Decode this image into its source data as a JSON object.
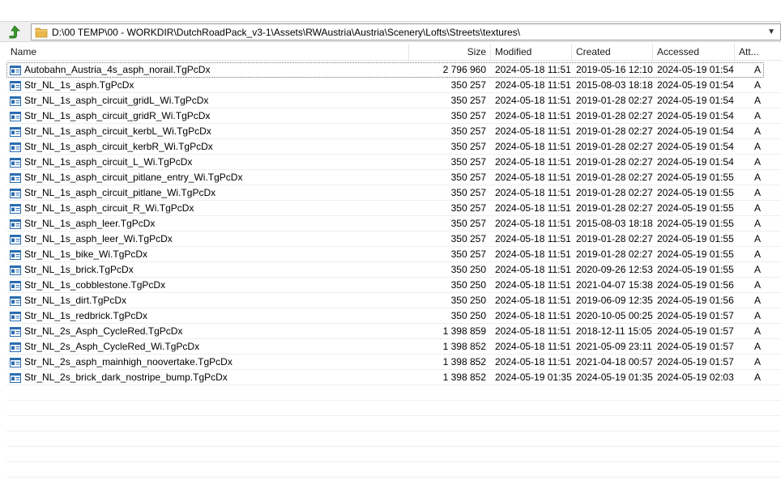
{
  "path_bar": {
    "path": "D:\\00 TEMP\\00 - WORKDIR\\DutchRoadPack_v3-1\\Assets\\RWAustria\\Austria\\Scenery\\Lofts\\Streets\\textures\\",
    "up_icon": "up-arrow-icon",
    "folder_icon": "folder-icon",
    "dropdown_icon": "chevron-down-icon"
  },
  "columns": {
    "name": "Name",
    "size": "Size",
    "modified": "Modified",
    "created": "Created",
    "accessed": "Accessed",
    "attributes": "Att..."
  },
  "files": [
    {
      "name": "Autobahn_Austria_4s_asph_norail.TgPcDx",
      "size": "2 796 960",
      "modified": "2024-05-18 11:51",
      "created": "2019-05-16 12:10",
      "accessed": "2024-05-19 01:54",
      "attr": "A"
    },
    {
      "name": "Str_NL_1s_asph.TgPcDx",
      "size": "350 257",
      "modified": "2024-05-18 11:51",
      "created": "2015-08-03 18:18",
      "accessed": "2024-05-19 01:54",
      "attr": "A"
    },
    {
      "name": "Str_NL_1s_asph_circuit_gridL_Wi.TgPcDx",
      "size": "350 257",
      "modified": "2024-05-18 11:51",
      "created": "2019-01-28 02:27",
      "accessed": "2024-05-19 01:54",
      "attr": "A"
    },
    {
      "name": "Str_NL_1s_asph_circuit_gridR_Wi.TgPcDx",
      "size": "350 257",
      "modified": "2024-05-18 11:51",
      "created": "2019-01-28 02:27",
      "accessed": "2024-05-19 01:54",
      "attr": "A"
    },
    {
      "name": "Str_NL_1s_asph_circuit_kerbL_Wi.TgPcDx",
      "size": "350 257",
      "modified": "2024-05-18 11:51",
      "created": "2019-01-28 02:27",
      "accessed": "2024-05-19 01:54",
      "attr": "A"
    },
    {
      "name": "Str_NL_1s_asph_circuit_kerbR_Wi.TgPcDx",
      "size": "350 257",
      "modified": "2024-05-18 11:51",
      "created": "2019-01-28 02:27",
      "accessed": "2024-05-19 01:54",
      "attr": "A"
    },
    {
      "name": "Str_NL_1s_asph_circuit_L_Wi.TgPcDx",
      "size": "350 257",
      "modified": "2024-05-18 11:51",
      "created": "2019-01-28 02:27",
      "accessed": "2024-05-19 01:54",
      "attr": "A"
    },
    {
      "name": "Str_NL_1s_asph_circuit_pitlane_entry_Wi.TgPcDx",
      "size": "350 257",
      "modified": "2024-05-18 11:51",
      "created": "2019-01-28 02:27",
      "accessed": "2024-05-19 01:55",
      "attr": "A"
    },
    {
      "name": "Str_NL_1s_asph_circuit_pitlane_Wi.TgPcDx",
      "size": "350 257",
      "modified": "2024-05-18 11:51",
      "created": "2019-01-28 02:27",
      "accessed": "2024-05-19 01:55",
      "attr": "A"
    },
    {
      "name": "Str_NL_1s_asph_circuit_R_Wi.TgPcDx",
      "size": "350 257",
      "modified": "2024-05-18 11:51",
      "created": "2019-01-28 02:27",
      "accessed": "2024-05-19 01:55",
      "attr": "A"
    },
    {
      "name": "Str_NL_1s_asph_leer.TgPcDx",
      "size": "350 257",
      "modified": "2024-05-18 11:51",
      "created": "2015-08-03 18:18",
      "accessed": "2024-05-19 01:55",
      "attr": "A"
    },
    {
      "name": "Str_NL_1s_asph_leer_Wi.TgPcDx",
      "size": "350 257",
      "modified": "2024-05-18 11:51",
      "created": "2019-01-28 02:27",
      "accessed": "2024-05-19 01:55",
      "attr": "A"
    },
    {
      "name": "Str_NL_1s_bike_Wi.TgPcDx",
      "size": "350 257",
      "modified": "2024-05-18 11:51",
      "created": "2019-01-28 02:27",
      "accessed": "2024-05-19 01:55",
      "attr": "A"
    },
    {
      "name": "Str_NL_1s_brick.TgPcDx",
      "size": "350 250",
      "modified": "2024-05-18 11:51",
      "created": "2020-09-26 12:53",
      "accessed": "2024-05-19 01:55",
      "attr": "A"
    },
    {
      "name": "Str_NL_1s_cobblestone.TgPcDx",
      "size": "350 250",
      "modified": "2024-05-18 11:51",
      "created": "2021-04-07 15:38",
      "accessed": "2024-05-19 01:56",
      "attr": "A"
    },
    {
      "name": "Str_NL_1s_dirt.TgPcDx",
      "size": "350 250",
      "modified": "2024-05-18 11:51",
      "created": "2019-06-09 12:35",
      "accessed": "2024-05-19 01:56",
      "attr": "A"
    },
    {
      "name": "Str_NL_1s_redbrick.TgPcDx",
      "size": "350 250",
      "modified": "2024-05-18 11:51",
      "created": "2020-10-05 00:25",
      "accessed": "2024-05-19 01:57",
      "attr": "A"
    },
    {
      "name": "Str_NL_2s_Asph_CycleRed.TgPcDx",
      "size": "1 398 859",
      "modified": "2024-05-18 11:51",
      "created": "2018-12-11 15:05",
      "accessed": "2024-05-19 01:57",
      "attr": "A"
    },
    {
      "name": "Str_NL_2s_Asph_CycleRed_Wi.TgPcDx",
      "size": "1 398 852",
      "modified": "2024-05-18 11:51",
      "created": "2021-05-09 23:11",
      "accessed": "2024-05-19 01:57",
      "attr": "A"
    },
    {
      "name": "Str_NL_2s_asph_mainhigh_noovertake.TgPcDx",
      "size": "1 398 852",
      "modified": "2024-05-18 11:51",
      "created": "2021-04-18 00:57",
      "accessed": "2024-05-19 01:57",
      "attr": "A"
    },
    {
      "name": "Str_NL_2s_brick_dark_nostripe_bump.TgPcDx",
      "size": "1 398 852",
      "modified": "2024-05-19 01:35",
      "created": "2024-05-19 01:35",
      "accessed": "2024-05-19 02:03",
      "attr": "A"
    }
  ],
  "file_icon": "texture-file-icon",
  "colors": {
    "up_arrow": "#3a9a2a",
    "folder": "#e8b84a",
    "file_icon": "#2b6cb0"
  }
}
